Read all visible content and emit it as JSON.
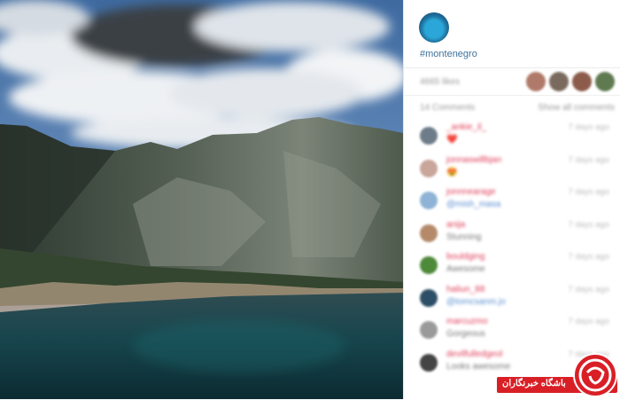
{
  "post": {
    "hashtag": "#montenegro",
    "likes_label": "4665 likes",
    "comments_count_label": "14 Comments",
    "show_all_label": "Show all comments"
  },
  "likers": [
    {
      "color": "#b07a6a"
    },
    {
      "color": "#7a6a5e"
    },
    {
      "color": "#8c5b4a"
    },
    {
      "color": "#5f7a50"
    }
  ],
  "comments": [
    {
      "username": "_ankie_il_",
      "text": "❤️",
      "time": "7 days ago",
      "avatar_color": "#6e7c8a",
      "link": false
    },
    {
      "username": "jonnaswillbjan",
      "text": "😍",
      "time": "7 days ago",
      "avatar_color": "#c9a59a",
      "link": false
    },
    {
      "username": "jonnnearage",
      "text": "@mish_masa",
      "time": "7 days ago",
      "avatar_color": "#8fb3d6",
      "link": true
    },
    {
      "username": "anija",
      "text": "Stunning",
      "time": "7 days ago",
      "avatar_color": "#b58a6a",
      "link": false
    },
    {
      "username": "bouldging",
      "text": "Awesome",
      "time": "7 days ago",
      "avatar_color": "#4f8a3a",
      "link": false
    },
    {
      "username": "haliun_88",
      "text": "@tomcsanm.jo",
      "time": "7 days ago",
      "avatar_color": "#2d4e66",
      "link": true
    },
    {
      "username": "marcuzmo",
      "text": "Gorgeous",
      "time": "7 days ago",
      "avatar_color": "#9a9a9a",
      "link": false
    },
    {
      "username": "devilfulledgeol",
      "text": "Looks awesome",
      "time": "7 days ago",
      "avatar_color": "#444444",
      "link": false
    }
  ],
  "watermark": {
    "text": "باشگاه خبرنگاران",
    "color": "#d91f26"
  }
}
